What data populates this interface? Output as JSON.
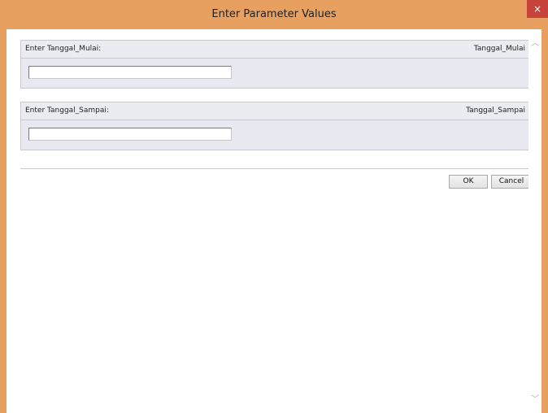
{
  "window": {
    "title": "Enter Parameter Values",
    "close_glyph": "×",
    "accent_color": "#e8a060",
    "close_color": "#c7423a"
  },
  "parameters": [
    {
      "label": "Enter Tanggal_Mulai:",
      "name": "Tanggal_Mulai",
      "value": "",
      "placeholder": ""
    },
    {
      "label": "Enter Tanggal_Sampai:",
      "name": "Tanggal_Sampai",
      "value": "",
      "placeholder": ""
    }
  ],
  "buttons": {
    "ok_label": "OK",
    "cancel_label": "Cancel"
  },
  "scrollbar": {
    "up_glyph": "︿",
    "down_glyph": "﹀"
  }
}
